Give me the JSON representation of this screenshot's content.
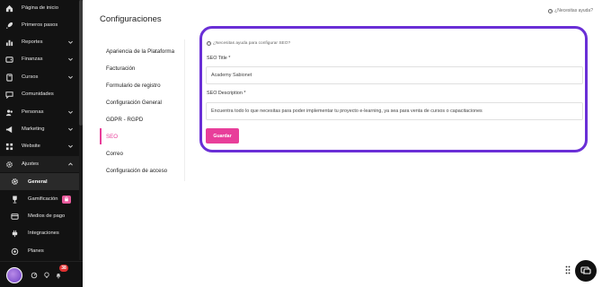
{
  "sidebar": {
    "items": [
      {
        "label": "Página de inicio",
        "icon": "home-icon"
      },
      {
        "label": "Primeros pasos",
        "icon": "rocket-icon"
      },
      {
        "label": "Reportes",
        "icon": "chart-icon"
      },
      {
        "label": "Finanzas",
        "icon": "wallet-icon"
      },
      {
        "label": "Cursos",
        "icon": "book-icon"
      },
      {
        "label": "Comunidades",
        "icon": "chat-icon"
      },
      {
        "label": "Personas",
        "icon": "users-icon"
      },
      {
        "label": "Marketing",
        "icon": "megaphone-icon"
      },
      {
        "label": "Website",
        "icon": "grid-icon"
      },
      {
        "label": "Ajustes",
        "icon": "gear-icon"
      }
    ],
    "ajustes_sub": [
      {
        "label": "General",
        "icon": "settings-cog-icon"
      },
      {
        "label": "Gamificación",
        "icon": "trophy-icon"
      },
      {
        "label": "Medios de pago",
        "icon": "card-icon"
      },
      {
        "label": "Integraciones",
        "icon": "plug-icon"
      },
      {
        "label": "Planes",
        "icon": "target-icon"
      }
    ],
    "notification_count": "38"
  },
  "header": {
    "title": "Configuraciones",
    "help_link": "¿Necesitas ayuda?"
  },
  "subnav": {
    "items": [
      "Apariencia de la Plataforma",
      "Facturación",
      "Formulario de registro",
      "Configuración General",
      "GDPR - RGPD",
      "SEO",
      "Correo",
      "Configuración de acceso"
    ],
    "active": "SEO"
  },
  "seo": {
    "help": "¿Necesitas ayuda para configurar SEO?",
    "title_label": "SEO Title *",
    "title_value": "Academy Sabionet",
    "description_label": "SEO Description *",
    "description_value": "Encuentra todo lo que necesitas para poder implementar tu proyecto e-learning, ya sea para venta de cursos o capacitaciones",
    "save_label": "Guardar"
  },
  "colors": {
    "accent": "#e83e9a",
    "highlight": "#6a2fd6",
    "sidebar_bg": "#121212"
  }
}
